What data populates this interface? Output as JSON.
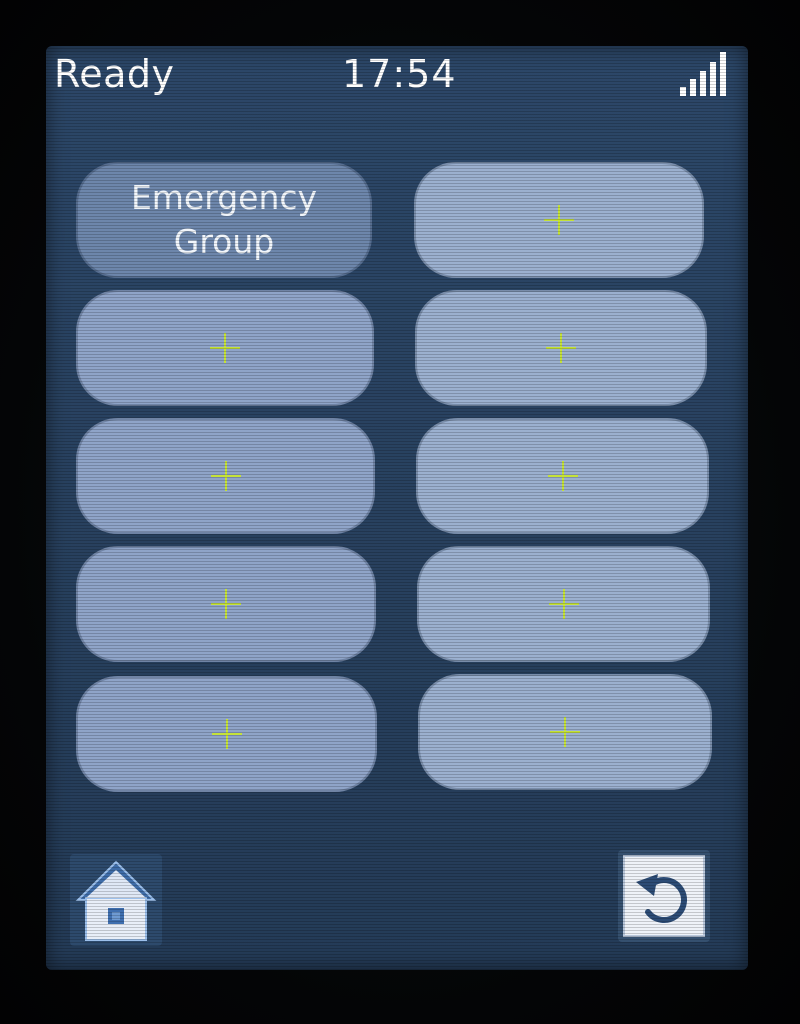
{
  "status_bar": {
    "status_text": "Ready",
    "time": "17:54",
    "signal_icon": "signal-strength-icon",
    "signal_level": 5
  },
  "tiles": [
    {
      "label_line1": "Emergency",
      "label_line2": "Group",
      "empty": false
    },
    {
      "empty": true,
      "icon": "plus-icon"
    },
    {
      "empty": true,
      "icon": "plus-icon"
    },
    {
      "empty": true,
      "icon": "plus-icon"
    },
    {
      "empty": true,
      "icon": "plus-icon"
    },
    {
      "empty": true,
      "icon": "plus-icon"
    },
    {
      "empty": true,
      "icon": "plus-icon"
    },
    {
      "empty": true,
      "icon": "plus-icon"
    },
    {
      "empty": true,
      "icon": "plus-icon"
    },
    {
      "empty": true,
      "icon": "plus-icon"
    }
  ],
  "bottom_bar": {
    "home_icon": "home-icon",
    "back_icon": "back-arrow-icon"
  },
  "colors": {
    "screen_bg": "#2a4464",
    "tile": "#8fa4c8",
    "group_tile": "#6d86ab",
    "plus": "#c5e23a",
    "text": "#ffffff"
  }
}
